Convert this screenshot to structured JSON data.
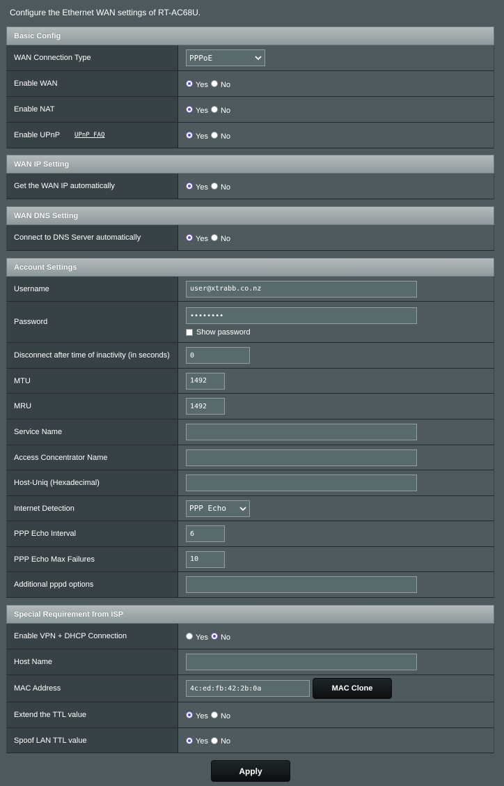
{
  "page": {
    "description": "Configure the Ethernet WAN settings of RT-AC68U."
  },
  "common": {
    "yes": "Yes",
    "no": "No"
  },
  "basic_config": {
    "title": "Basic Config",
    "wan_type_label": "WAN Connection Type",
    "wan_type_value": "PPPoE",
    "enable_wan_label": "Enable WAN",
    "enable_wan": "Yes",
    "enable_nat_label": "Enable NAT",
    "enable_nat": "Yes",
    "enable_upnp_label": "Enable UPnP",
    "upnp_faq": "UPnP FAQ",
    "enable_upnp": "Yes"
  },
  "wan_ip": {
    "title": "WAN IP Setting",
    "auto_label": "Get the WAN IP automatically",
    "auto": "Yes"
  },
  "wan_dns": {
    "title": "WAN DNS Setting",
    "auto_label": "Connect to DNS Server automatically",
    "auto": "Yes"
  },
  "account": {
    "title": "Account Settings",
    "username_label": "Username",
    "username": "user@xtrabb.co.nz",
    "password_label": "Password",
    "password": "••••••••",
    "show_password": "Show password",
    "idle_label": "Disconnect after time of inactivity (in seconds)",
    "idle": "0",
    "mtu_label": "MTU",
    "mtu": "1492",
    "mru_label": "MRU",
    "mru": "1492",
    "service_label": "Service Name",
    "service": "",
    "ac_label": "Access Concentrator Name",
    "ac": "",
    "hostuniq_label": "Host-Uniq (Hexadecimal)",
    "hostuniq": "",
    "detection_label": "Internet Detection",
    "detection": "PPP Echo",
    "echo_interval_label": "PPP Echo Interval",
    "echo_interval": "6",
    "echo_fail_label": "PPP Echo Max Failures",
    "echo_fail": "10",
    "pppd_label": "Additional pppd options",
    "pppd": ""
  },
  "isp": {
    "title": "Special Requirement from ISP",
    "vpn_label": "Enable VPN + DHCP Connection",
    "vpn": "No",
    "hostname_label": "Host Name",
    "hostname": "",
    "mac_label": "MAC Address",
    "mac": "4c:ed:fb:42:2b:0a",
    "mac_clone": "MAC Clone",
    "ttl_label": "Extend the TTL value",
    "ttl": "Yes",
    "spoof_label": "Spoof LAN TTL value",
    "spoof": "Yes"
  },
  "apply_label": "Apply"
}
